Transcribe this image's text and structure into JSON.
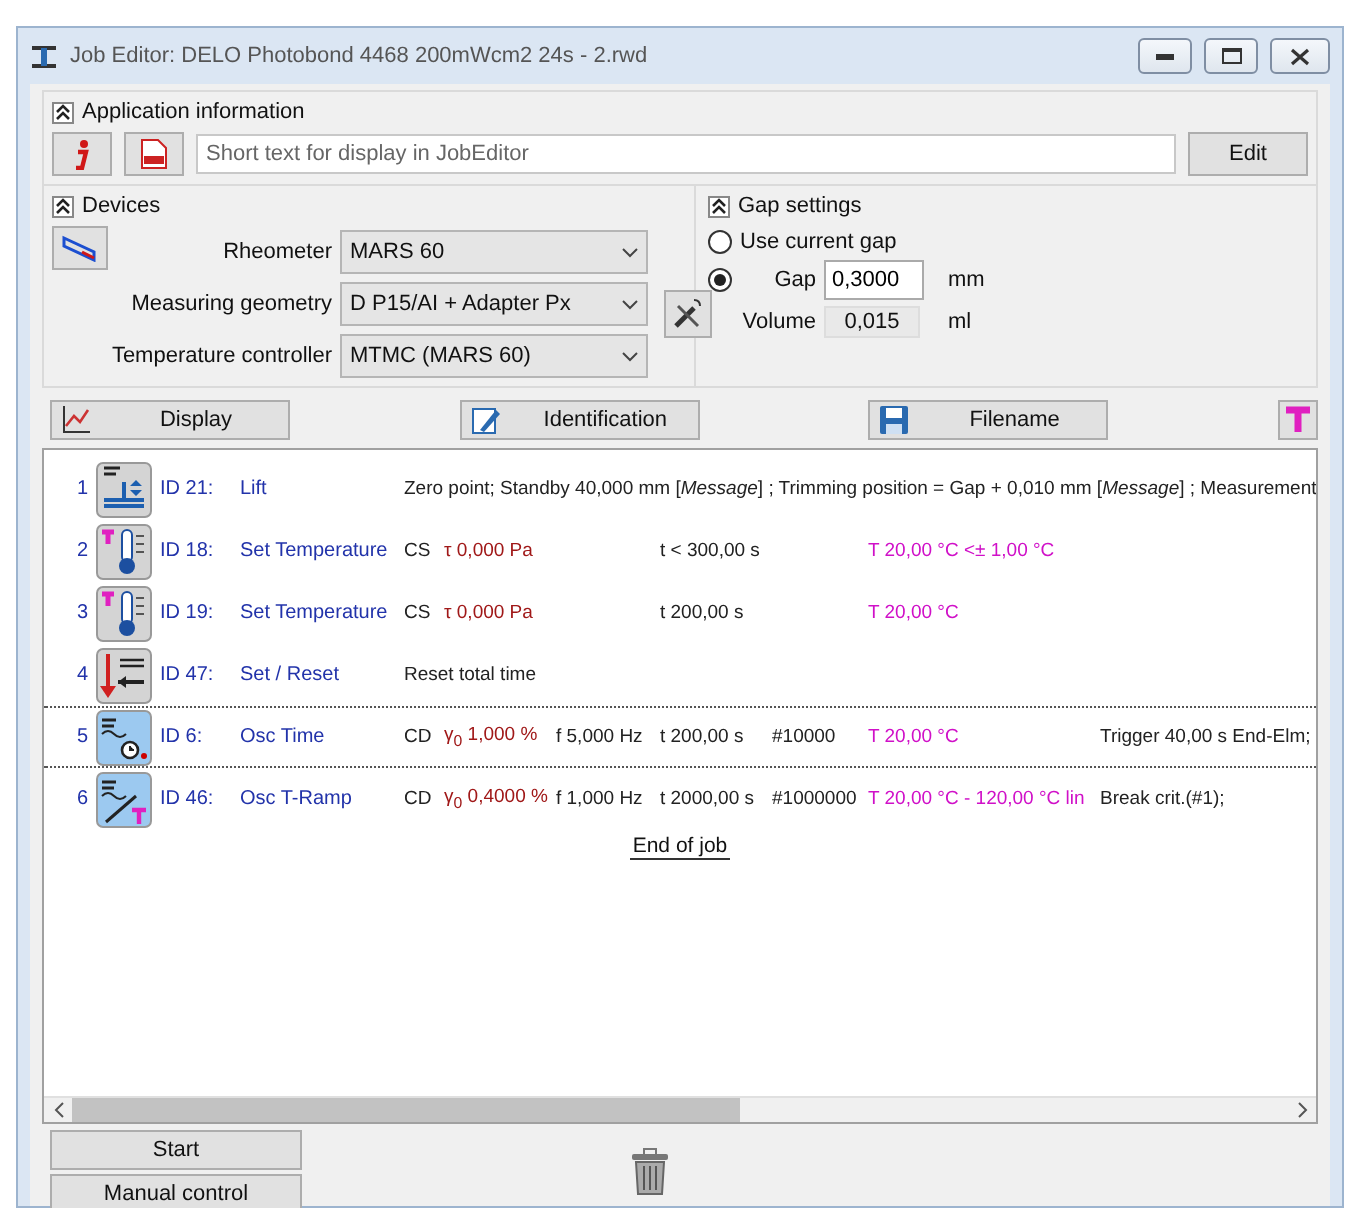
{
  "window": {
    "title": "Job Editor: DELO Photobond 4468 200mWcm2 24s - 2.rwd"
  },
  "application_information": {
    "title": "Application information",
    "expanded": true,
    "short_text": {
      "placeholder": "Short text for display in JobEditor"
    },
    "edit_button": "Edit"
  },
  "devices": {
    "title": "Devices",
    "expanded": true,
    "fields": [
      {
        "label": "Rheometer",
        "value": "MARS 60"
      },
      {
        "label": "Measuring geometry",
        "value": "D P15/AI + Adapter Px"
      },
      {
        "label": "Temperature controller",
        "value": "MTMC (MARS 60)"
      }
    ]
  },
  "gap_settings": {
    "title": "Gap settings",
    "expanded": true,
    "options": [
      {
        "label": "Use current gap",
        "selected": false
      },
      {
        "label": "Gap",
        "selected": true,
        "value": "0,3000",
        "unit": "mm"
      }
    ],
    "volume": {
      "label": "Volume",
      "value": "0,015",
      "unit": "ml"
    }
  },
  "toolbar": [
    {
      "kind": "display",
      "label": "Display"
    },
    {
      "kind": "identification",
      "label": "Identification"
    },
    {
      "kind": "filename",
      "label": "Filename"
    }
  ],
  "job_steps": [
    {
      "number": "1",
      "kind": "lift",
      "id": "ID 21:",
      "name": "Lift",
      "selected": false,
      "description": "Zero point; Standby 40,000 mm [*Message*] ; Trimming position = Gap  + 0,010 mm [*Message*] ; Measurement"
    },
    {
      "number": "2",
      "kind": "temperature",
      "id": "ID 18:",
      "name": "Set Temperature",
      "selected": false,
      "mode": "CS",
      "amplitude": "τ 0,000 Pa",
      "duration": "t < 300,00 s",
      "temperature": "T 20,00 °C <± 1,00 °C"
    },
    {
      "number": "3",
      "kind": "temperature",
      "id": "ID 19:",
      "name": "Set Temperature",
      "selected": false,
      "mode": "CS",
      "amplitude": "τ 0,000 Pa",
      "duration": "t 200,00 s",
      "temperature": "T 20,00 °C"
    },
    {
      "number": "4",
      "kind": "set",
      "id": "ID 47:",
      "name": "Set / Reset",
      "selected": false,
      "description": "Reset total time"
    },
    {
      "number": "5",
      "kind": "osc-time",
      "id": "ID 6:",
      "name": "Osc Time",
      "selected": true,
      "mode": "CD",
      "amplitude": "γ$_{0}$ 1,000 %",
      "frequency": "f 5,000 Hz",
      "duration": "t 200,00 s",
      "count": "#10000",
      "temperature": "T 20,00 °C",
      "trigger": "Trigger 40,00 s  End-Elm;"
    },
    {
      "number": "6",
      "kind": "osc-ramp",
      "id": "ID 46:",
      "name": "Osc T-Ramp",
      "selected": false,
      "mode": "CD",
      "amplitude": "γ$_{0}$ 0,4000 %",
      "frequency": "f 1,000 Hz",
      "duration": "t 2000,00 s",
      "count": "#1000000",
      "temperature": "T 20,00 °C - 120,00 °C lin",
      "trigger": "Break crit.(#1);"
    }
  ],
  "end_label": "End of job",
  "bottom_buttons": [
    "Start",
    "Manual control"
  ]
}
